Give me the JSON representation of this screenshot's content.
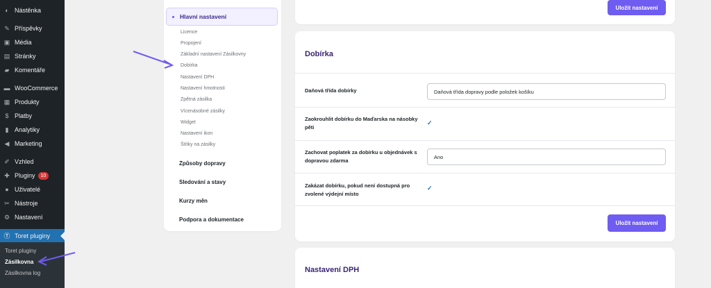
{
  "sidebar": {
    "items": [
      {
        "label": "Nástěnka",
        "icon": "dashboard-icon"
      },
      {
        "label": "Příspěvky",
        "icon": "pin-icon"
      },
      {
        "label": "Média",
        "icon": "media-icon"
      },
      {
        "label": "Stránky",
        "icon": "pages-icon"
      },
      {
        "label": "Komentáře",
        "icon": "comments-icon"
      },
      {
        "label": "WooCommerce",
        "icon": "woocommerce-icon"
      },
      {
        "label": "Produkty",
        "icon": "products-icon"
      },
      {
        "label": "Platby",
        "icon": "payments-icon"
      },
      {
        "label": "Analytiky",
        "icon": "analytics-icon"
      },
      {
        "label": "Marketing",
        "icon": "marketing-icon"
      },
      {
        "label": "Vzhled",
        "icon": "appearance-icon"
      },
      {
        "label": "Pluginy",
        "icon": "plugins-icon",
        "badge": "10"
      },
      {
        "label": "Uživatelé",
        "icon": "users-icon"
      },
      {
        "label": "Nástroje",
        "icon": "tools-icon"
      },
      {
        "label": "Nastavení",
        "icon": "settings-icon"
      },
      {
        "label": "Toret pluginy",
        "icon": "toret-icon"
      }
    ],
    "submenu": [
      "Toret pluginy",
      "Zásilkovna",
      "Zásilkovna log"
    ]
  },
  "nav": {
    "main": "Hlavní nastavení",
    "sub": [
      "Licence",
      "Propojení",
      "Základní nastavení Zásilkovny",
      "Dobírka",
      "Nastavení DPH",
      "Nastavení hmotnosti",
      "Zpětná zásilka",
      "Vícenásobné zásilky",
      "Widget",
      "Nastavení ikon",
      "Štítky na zásilky"
    ],
    "sections": [
      "Způsoby dopravy",
      "Sledování a stavy",
      "Kurzy měn",
      "Podpora a dokumentace"
    ]
  },
  "save_label": "Uložit nastavení",
  "dobirka": {
    "title": "Dobírka",
    "tax_label": "Daňová třída dobírky",
    "tax_value": "Daňová třída dopravy podle položek košíku",
    "round_label": "Zaokrouhlit dobírku do Maďarska na násobky pěti",
    "keep_label": "Zachovat poplatek za dobírku u objednávek s dopravou zdarma",
    "keep_value": "Ano",
    "disable_label": "Zakázat dobírku, pokud není dostupná pro zvolené výdejní místo"
  },
  "dph": {
    "title": "Nastavení DPH"
  },
  "colors": {
    "accent": "#6f5cf0",
    "sidebar": "#1d2327",
    "active": "#2271b1"
  }
}
